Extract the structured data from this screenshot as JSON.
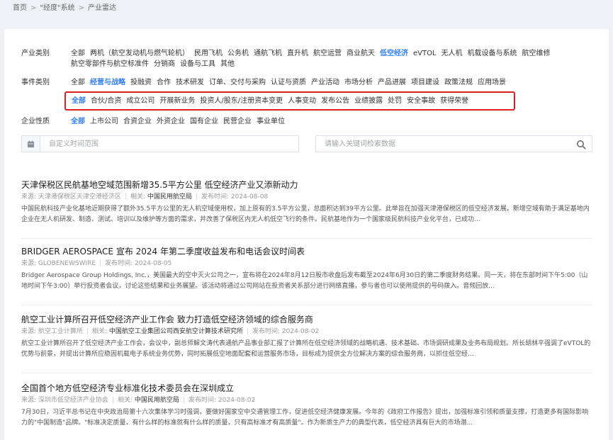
{
  "breadcrumb": [
    "首页",
    "\"经度\"系统",
    "产业雷达"
  ],
  "filters": {
    "industry": {
      "label": "产业类别",
      "options": [
        "全部",
        "两机（航空发动机与燃气轮机）",
        "民用飞机",
        "公务机",
        "通航飞机",
        "直升机",
        "航空运营",
        "商业航天",
        "低空经济",
        "eVTOL",
        "无人机",
        "机载设备与系统",
        "航空维修",
        "航空零部件与航空标准件",
        "分销商",
        "设备与工具",
        "其他"
      ],
      "active": "低空经济"
    },
    "event": {
      "label": "事件类别",
      "options": [
        "全部",
        "经营与战略",
        "投融资",
        "合作",
        "技术研发",
        "订单、交付与采购",
        "认证与资质",
        "产业活动",
        "市场分析",
        "产品进展",
        "项目建设",
        "政策法规",
        "应用场景"
      ],
      "active": "经营与战略"
    },
    "event_sub": {
      "options": [
        "全部",
        "合伙/合资",
        "成立公司",
        "开展新业务",
        "投资人/股东/注册资本变更",
        "人事变动",
        "发布公告",
        "业绩披露",
        "处罚",
        "安全事故",
        "获得荣誉"
      ],
      "active": "全部"
    },
    "enterprise": {
      "label": "企业性质",
      "options": [
        "全部",
        "上市公司",
        "合资企业",
        "外资企业",
        "国有企业",
        "民营企业",
        "事业单位"
      ],
      "active": "全部"
    }
  },
  "date_input": {
    "placeholder": "自定义时间范围"
  },
  "search_input": {
    "placeholder": "请输入关键词检索数据"
  },
  "articles": [
    {
      "title": "天津保税区民航基地空域范围新增35.5平方公里 低空经济产业又添新动力",
      "source_label": "来源:",
      "source": "天津港保税区天津空港经济区",
      "related_label": "相关:",
      "related": "中国民用航空局",
      "time_label": "发布时间:",
      "time": "2024-08-08",
      "summary": "中国民航科技产业化基地近期获得了额外35.5平方公里的无人机空域使用权，加上原有的3.5平方公里，总面积达到39平方公里。此举旨在加强天津港保税区的低空经济发展。新增空域有助于满足基地内企业在无人机研发、制造、测试、培训以及维护等方面的需求，并改善了保税区内无人机低空飞行的条件。民航基地作为一个国家级民航科技产业化平台，已成功..."
    },
    {
      "title": "BRIDGER AEROSPACE 宣布 2024 年第二季度收益发布和电话会议时间表",
      "source_label": "来源:",
      "source": "GLOBENEWSWIRE",
      "related_label": "",
      "related": "",
      "time_label": "发布时间:",
      "time": "2024-08-05",
      "summary": "Bridger Aerospace Group Holdings, Inc.，美国最大的空中灭火公司之一，宣布将在2024年8月12日股市收盘后发布截至2024年6月30日的第二季度财务结果。同一天，将在东部时间下午5:00（山地时间下午3:00）举行投资者会议，讨论这些结果和业务展望。该活动将通过公司网站在投资者关系部分进行网络直播，参与者也可以使用提供的号码拨入。音频回放..."
    },
    {
      "title": "航空工业计算所召开低空经济产业工作会 致力打造低空经济领域的综合服务商",
      "source_label": "来源:",
      "source": "航空工业计算所",
      "related_label": "相关:",
      "related": "中国航空工业集团公司西安航空计算技术研究所",
      "time_label": "发布时间:",
      "time": "2024-08-02",
      "summary": "航空工业计算所召开了低空经济产业工作会，会议中，副总师解文涛代表通航产品事业部汇报了计算所在低空经济领域的战略机遇、技术基础、市场调研成果及业务布局规划。所长胡林平强调了eVTOL的优势与前景，并提出计算所应稳固机载电子系统业务优势，同时拓展低空地面配套和运营服务市场，目标成为提供全方位解决方案的综合服务商，以抓住低空经..."
    },
    {
      "title": "全国首个地方低空经济专业标准化技术委员会在深圳成立",
      "source_label": "来源:",
      "source": "深圳市低空经济产业协会",
      "related_label": "相关:",
      "related": "中国民用航空局",
      "time_label": "发布时间:",
      "time": "2024-08-02",
      "summary": "7月30日，习近平总书记在中央政治局第十六次集体学习时强调，要做好国家空中交通管理工作，促进低空经济健康发展。今年的《政府工作报告》提出，加强标准引领和质量支撑，打造更多有国际影响力的\"中国制造\"品牌。\"标准决定质量，有什么样的标准就有什么样的质量，只有高标准才有高质量\"。作为新质生产力的典型代表，低空经济具有巨大的市场潜..."
    }
  ],
  "colors": {
    "accent": "#2f7df6",
    "highlight_box": "#e02020"
  },
  "icons": {
    "date": "calendar-icon",
    "search": "search-icon"
  }
}
